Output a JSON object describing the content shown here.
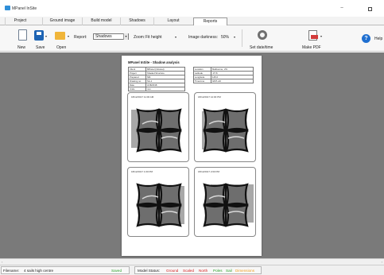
{
  "window": {
    "title": "MPanel InSite"
  },
  "tabs": [
    {
      "label": "Project",
      "active": false
    },
    {
      "label": "Ground image",
      "active": false
    },
    {
      "label": "Build model",
      "active": false
    },
    {
      "label": "Shadows",
      "active": false
    },
    {
      "label": "Layout",
      "active": false
    },
    {
      "label": "Reports",
      "active": true
    }
  ],
  "toolbar": {
    "new_label": "New",
    "save_label": "Save",
    "open_label": "Open",
    "report_label": "Report:",
    "report_value": "Shadows",
    "zoom_label": "Zoom:",
    "zoom_value": "Fit height",
    "darkness_label": "Image darkness:",
    "darkness_value": "50%",
    "set_datetime_label": "Set date/time",
    "make_pdf_label": "Make PDF",
    "help_label": "Help"
  },
  "report": {
    "title": "MPanel InSite - Shadow analysis",
    "info_left": [
      [
        "Client",
        "MPanel (Intranet)"
      ],
      [
        "Project",
        "Shaded Structure"
      ],
      [
        "Prepared",
        "NM"
      ],
      [
        "Drawing no.",
        "SA-1"
      ],
      [
        "Date",
        "4/18/2018"
      ],
      [
        "Units",
        "mm"
      ]
    ],
    "info_right": [
      [
        "Location",
        "Melbourne, VIC"
      ],
      [
        "Latitude",
        "-37.8"
      ],
      [
        "Longitude",
        "145.0"
      ],
      [
        "Timezone",
        "GMT+10"
      ]
    ],
    "panels": [
      {
        "timestamp": "18/12/2017 11:00 AM"
      },
      {
        "timestamp": "18/12/2017 12:00 PM"
      },
      {
        "timestamp": "18/12/2017 1:00 PM"
      },
      {
        "timestamp": "18/12/2017 2:00 PM"
      }
    ]
  },
  "status": {
    "filename_label": "Filename:",
    "filename_value": "4 sails high centre",
    "saved_label": "Saved",
    "model_status_label": "Model Status:",
    "items": [
      {
        "label": "Ground",
        "color": "#d62020"
      },
      {
        "label": "Scaled",
        "color": "#d62020"
      },
      {
        "label": "North",
        "color": "#d62020"
      },
      {
        "label": "Poles",
        "color": "#2aa32a"
      },
      {
        "label": "Sail",
        "color": "#2aa32a"
      },
      {
        "label": "Dimensions",
        "color": "#f0a020"
      }
    ]
  },
  "colors": {
    "workarea": "#7a7a7a",
    "accent": "#1f6fd0",
    "saved": "#2aa32a"
  }
}
